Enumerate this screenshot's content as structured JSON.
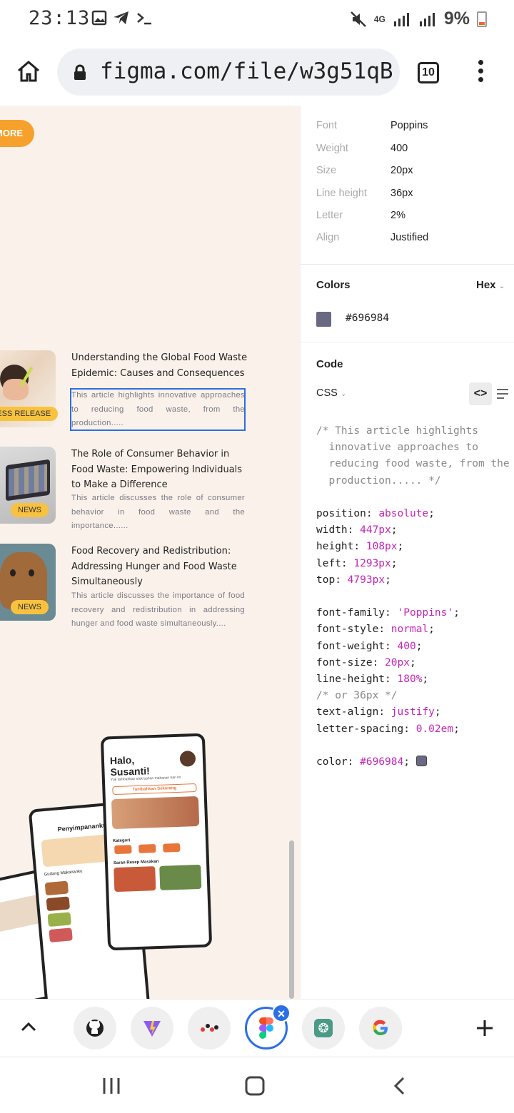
{
  "status_bar": {
    "time": "23:13",
    "network": "4G",
    "battery": "9%"
  },
  "browser": {
    "url": "figma.com/file/w3g51qB",
    "tab_count": "10"
  },
  "canvas": {
    "more_button": "MORE",
    "articles": [
      {
        "title": "Understanding the Global Food Waste Epidemic: Causes and Consequences",
        "description": "This article highlights innovative approaches to reducing food waste, from the production.....",
        "badge": "PRESS RELEASE"
      },
      {
        "title": "The Role of Consumer Behavior in Food Waste: Empowering Individuals to Make a Difference",
        "description": "This article discusses the role of consumer behavior in food waste and the importance......",
        "badge": "NEWS"
      },
      {
        "title": "Food Recovery and Redistribution: Addressing Hunger and Food Waste Simultaneously",
        "description": "This article discusses the importance of food recovery and redistribution in addressing hunger and food waste simultaneously....",
        "badge": "NEWS"
      }
    ],
    "mockup": {
      "greeting": "Halo,",
      "name": "Susanti!",
      "subtitle": "Yuk tambahkan stok bahan makanan hari ini",
      "cta": "Tambahkan Sekarang",
      "category_label": "Kategori",
      "recipes_label": "Saran Resep Masakan",
      "storage_title": "Penyimpananku",
      "storage_label": "Gudang Makananku"
    }
  },
  "inspector": {
    "typography": [
      {
        "label": "Font",
        "value": "Poppins"
      },
      {
        "label": "Weight",
        "value": "400"
      },
      {
        "label": "Size",
        "value": "20px"
      },
      {
        "label": "Line height",
        "value": "36px"
      },
      {
        "label": "Letter",
        "value": "2%"
      },
      {
        "label": "Align",
        "value": "Justified"
      }
    ],
    "colors_header": "Colors",
    "color_format": "Hex",
    "color_value": "#696984",
    "code_header": "Code",
    "code_language": "CSS",
    "code_comment": "/* This article highlights\n  innovative approaches to\n  reducing food waste, from the\n  production..... */",
    "css": [
      {
        "prop": "position",
        "val": "absolute"
      },
      {
        "prop": "width",
        "val": "447px"
      },
      {
        "prop": "height",
        "val": "108px"
      },
      {
        "prop": "left",
        "val": "1293px"
      },
      {
        "prop": "top",
        "val": "4793px"
      },
      {
        "prop": "font-family",
        "val": "'Poppins'"
      },
      {
        "prop": "font-style",
        "val": "normal"
      },
      {
        "prop": "font-weight",
        "val": "400"
      },
      {
        "prop": "font-size",
        "val": "20px"
      },
      {
        "prop": "line-height",
        "val": "180%"
      },
      {
        "prop": "text-align",
        "val": "justify"
      },
      {
        "prop": "letter-spacing",
        "val": "0.02em"
      },
      {
        "prop": "color",
        "val": "#696984"
      }
    ],
    "line_height_comment": "/* or 36px */"
  },
  "theme": {
    "accent": "#f7a12d",
    "badge": "#f8c23e",
    "selection": "#2b6ee6",
    "canvas_bg": "#faf2ea",
    "code_keyword": "#c426b8"
  }
}
